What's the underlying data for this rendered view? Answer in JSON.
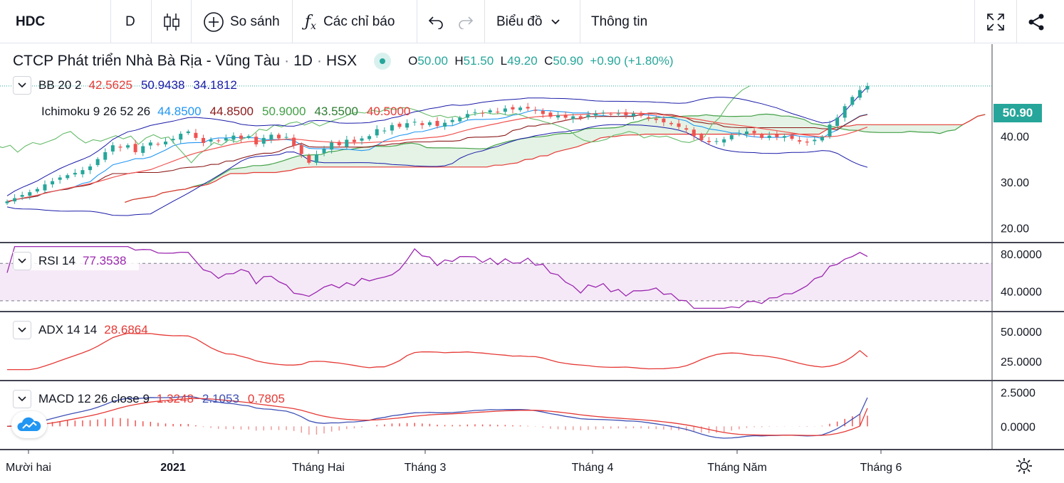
{
  "toolbar": {
    "symbol": "HDC",
    "interval": "D",
    "compare_label": "So sánh",
    "indicators_label": "Các chỉ báo",
    "chart_type_label": "Biểu đồ",
    "info_label": "Thông tin",
    "icons": [
      "candles-icon",
      "plus-circle-icon",
      "fx-icon",
      "undo-icon",
      "redo-icon",
      "chevron-down-icon",
      "fullscreen-icon",
      "share-icon"
    ]
  },
  "header": {
    "company": "CTCP Phát triển Nhà Bà Rịa - Vũng Tàu",
    "dot1": "·",
    "timeframe": "1D",
    "dot2": "·",
    "exchange": "HSX",
    "o_label": "O",
    "o_value": "50.00",
    "h_label": "H",
    "h_value": "51.50",
    "l_label": "L",
    "l_value": "49.20",
    "c_label": "C",
    "c_value": "50.90",
    "change": "+0.90 (+1.80%)",
    "last_price": "50.90"
  },
  "legends": {
    "bb": {
      "label": "BB 20 2",
      "v1": "42.5625",
      "v2": "50.9438",
      "v3": "34.1812"
    },
    "ichimoku": {
      "label": "Ichimoku 9 26 52 26",
      "v1": "44.8500",
      "v2": "44.8500",
      "v3": "50.9000",
      "v4": "43.5500",
      "v5": "40.5000"
    },
    "rsi": {
      "label": "RSI 14",
      "v1": "77.3538"
    },
    "adx": {
      "label": "ADX 14 14",
      "v1": "28.6864"
    },
    "macd": {
      "label": "MACD 12 26 close 9",
      "v1": "1.3248",
      "v2": "2.1053",
      "v3": "0.7805"
    }
  },
  "colors": {
    "up": "#26a69a",
    "down": "#ef5350",
    "bb_mid": "#ef5350",
    "bb_band": "#1a1aa8",
    "tenkan": "#2196f3",
    "kijun": "#8b1a1a",
    "span_a": "#43a047",
    "span_b": "#e53935",
    "chikou": "#66bb6a",
    "rsi": "#9c27b0",
    "adx": "#e53935",
    "macd": "#3f51b5",
    "signal": "#e53935"
  },
  "x_axis": {
    "labels": [
      "Mười hai",
      "2021",
      "Tháng Hai",
      "Tháng 3",
      "Tháng 4",
      "Tháng Năm",
      "Tháng 6"
    ]
  },
  "chart_data": [
    {
      "type": "candlestick",
      "title": "CTCP Phát triển Nhà Bà Rịa - Vũng Tàu · 1D · HSX",
      "y_ticks": [
        "40.00",
        "30.00",
        "20.00"
      ],
      "ylim": [
        17,
        60
      ],
      "close_approx": [
        25.8,
        26.5,
        27.2,
        27.8,
        28.5,
        29.5,
        30.2,
        31.0,
        31.5,
        32.0,
        32.6,
        33.4,
        35.0,
        36.5,
        38.0,
        37.5,
        38.0,
        36.5,
        37.8,
        38.6,
        38.2,
        38.8,
        39.4,
        40.5,
        41.0,
        39.6,
        38.5,
        39.2,
        38.9,
        39.5,
        40.1,
        39.4,
        40.0,
        38.2,
        39.6,
        40.3,
        39.5,
        39.8,
        37.9,
        36.1,
        34.2,
        36.0,
        37.2,
        38.6,
        38.0,
        39.2,
        38.7,
        39.5,
        40.0,
        41.5,
        41.2,
        42.4,
        42.0,
        42.8,
        43.1,
        42.4,
        43.0,
        42.2,
        42.9,
        43.5,
        44.0,
        44.8,
        45.2,
        45.0,
        45.6,
        45.3,
        46.0,
        45.8,
        46.2,
        46.0,
        45.5,
        44.8,
        44.2,
        44.5,
        44.0,
        44.3,
        43.8,
        44.6,
        44.9,
        45.1,
        44.8,
        44.9,
        44.5,
        44.9,
        44.4,
        43.8,
        43.5,
        43.0,
        42.6,
        42.0,
        41.4,
        40.0,
        39.1,
        38.7,
        38.9,
        39.3,
        40.2,
        40.5,
        41.0,
        40.6,
        39.6,
        40.1,
        39.8,
        40.0,
        39.4,
        38.8,
        38.6,
        39.2,
        39.8,
        42.5,
        44.0,
        46.5,
        48.5,
        50.0,
        50.9
      ]
    },
    {
      "type": "line",
      "title": "RSI 14",
      "y_ticks": [
        "80.0000",
        "40.0000"
      ],
      "ylim": [
        20,
        90
      ],
      "last": 77.3538
    },
    {
      "type": "line",
      "title": "ADX 14 14",
      "y_ticks": [
        "50.0000",
        "25.0000"
      ],
      "ylim": [
        10,
        65
      ],
      "last": 28.6864
    },
    {
      "type": "line+histogram",
      "title": "MACD 12 26 close 9",
      "y_ticks": [
        "2.5000",
        "0.0000"
      ],
      "ylim": [
        -1.6,
        3.2
      ],
      "macd_last": 2.1053,
      "signal_last": 1.3248,
      "hist_last": 0.7805
    }
  ]
}
